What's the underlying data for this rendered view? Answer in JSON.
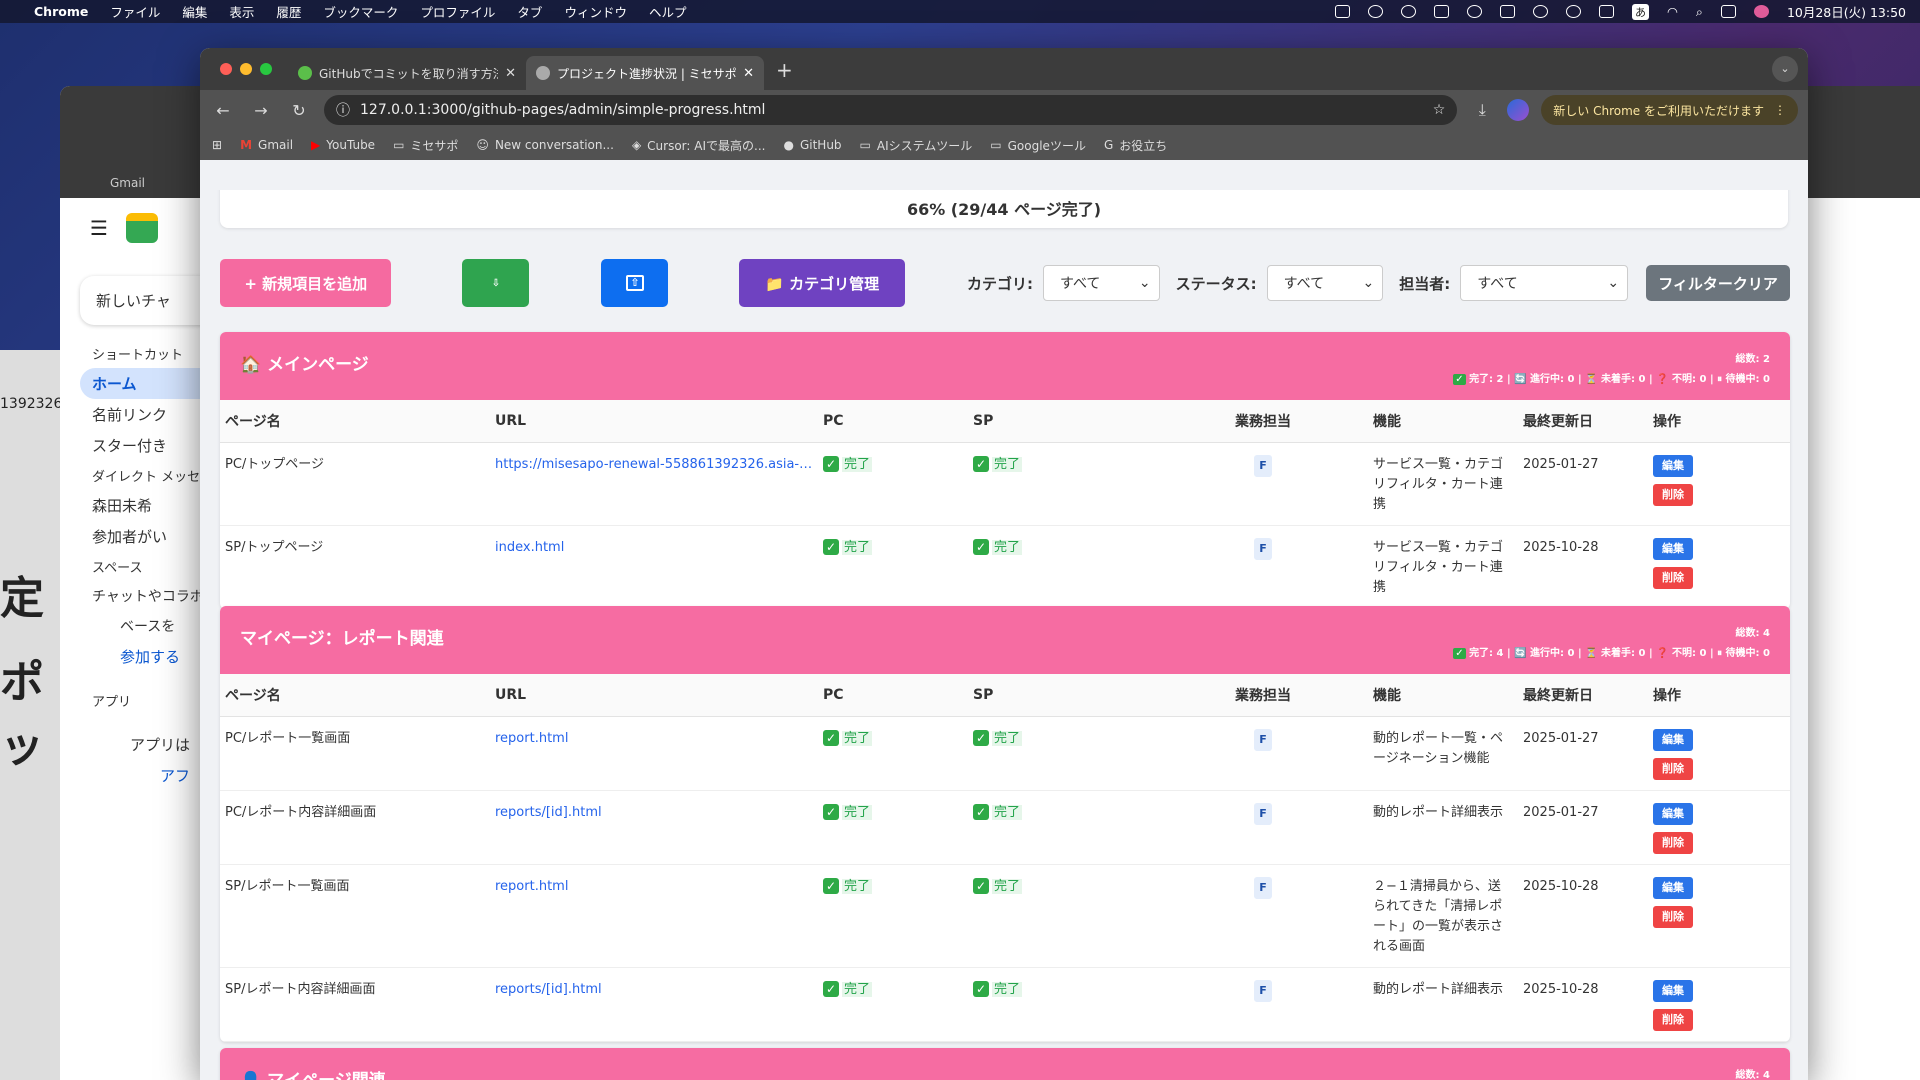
{
  "menubar": {
    "app": "Chrome",
    "items": [
      "ファイル",
      "編集",
      "表示",
      "履歴",
      "ブックマーク",
      "プロファイル",
      "タブ",
      "ウィンドウ",
      "ヘルプ"
    ],
    "clock": "10月28日(火) 13:50",
    "ime": "あ"
  },
  "bg_window": {
    "new_chat": "新しいチャ",
    "shortcuts": "ショートカット",
    "home": "ホーム",
    "mentions": "名前リンク",
    "starred": "スター付き",
    "dm": "ダイレクト メッセ",
    "person1": "森田未希",
    "person2": "参加者がい",
    "spaces": "スペース",
    "spaces_text": "チャットやコラボ",
    "spaces_text2": "ベースを",
    "join": "参加する",
    "apps": "アプリ",
    "apps_text": "アプリは",
    "apps_link": "アフ",
    "gmail": "Gmail",
    "far_left_id": "1392326",
    "far_left_big1": "定",
    "far_left_big2": "ポッ"
  },
  "tabs": [
    {
      "title": "GitHubでコミットを取り消す方法"
    },
    {
      "title": "プロジェクト進捗状況 | ミセサポ"
    }
  ],
  "address": "127.0.0.1:3000/github-pages/admin/simple-progress.html",
  "update_notice": "新しい Chrome をご利用いただけます",
  "bookmarks": [
    "Gmail",
    "YouTube",
    "ミセサポ",
    "New conversation...",
    "Cursor: AIで最高の...",
    "GitHub",
    "AIシステムツール",
    "Googleツール",
    "お役立ち"
  ],
  "progress_text": "66% (29/44 ページ完了)",
  "toolbar": {
    "add_label": "+ 新規項目を追加",
    "download_icon": "⇩",
    "upload_icon": "⇧",
    "category_label": "📁 カテゴリ管理",
    "category_filter_label": "カテゴリ:",
    "status_filter_label": "ステータス:",
    "assignee_filter_label": "担当者:",
    "category_value": "すべて",
    "status_value": "すべて",
    "assignee_value": "すべて",
    "clear_label": "フィルタークリア"
  },
  "columns": [
    "ページ名",
    "URL",
    "PC",
    "SP",
    "業務担当",
    "機能",
    "最終更新日",
    "操作"
  ],
  "done_label": "完了",
  "edit_label": "編集",
  "delete_label": "削除",
  "sections": [
    {
      "title": "🏠 メインページ",
      "total": "総数: 2",
      "stats": "完了: 2 | 🔄 進行中: 0 | ⏳ 未着手: 0 | ❓ 不明: 0 | ⏸ 待機中: 0",
      "rows": [
        {
          "name": "PC/トップページ",
          "url": "https://misesapo-renewal-558861392326.asia-nort...",
          "assignee": "F",
          "feature": "サービス一覧・カテゴリフィルタ・カート連携",
          "updated": "2025-01-27"
        },
        {
          "name": "SP/トップページ",
          "url": "index.html",
          "assignee": "F",
          "feature": "サービス一覧・カテゴリフィルタ・カート連携",
          "updated": "2025-10-28"
        }
      ]
    },
    {
      "title": "マイページ：レポート関連",
      "total": "総数: 4",
      "stats": "完了: 4 | 🔄 進行中: 0 | ⏳ 未着手: 0 | ❓ 不明: 0 | ⏸ 待機中: 0",
      "rows": [
        {
          "name": "PC/レポート一覧画面",
          "url": "report.html",
          "assignee": "F",
          "feature": "動的レポート一覧・ページネーション機能",
          "updated": "2025-01-27"
        },
        {
          "name": "PC/レポート内容詳細画面",
          "url": "reports/[id].html",
          "assignee": "F",
          "feature": "動的レポート詳細表示",
          "updated": "2025-01-27"
        },
        {
          "name": "SP/レポート一覧画面",
          "url": "report.html",
          "assignee": "F",
          "feature": "２−１清掃員から、送られてきた「清掃レポート」の一覧が表示される画面",
          "updated": "2025-10-28"
        },
        {
          "name": "SP/レポート内容詳細画面",
          "url": "reports/[id].html",
          "assignee": "F",
          "feature": "動的レポート詳細表示",
          "updated": "2025-10-28"
        }
      ]
    },
    {
      "title": "👤 マイページ関連",
      "total": "総数: 4",
      "stats": "",
      "rows": []
    }
  ]
}
